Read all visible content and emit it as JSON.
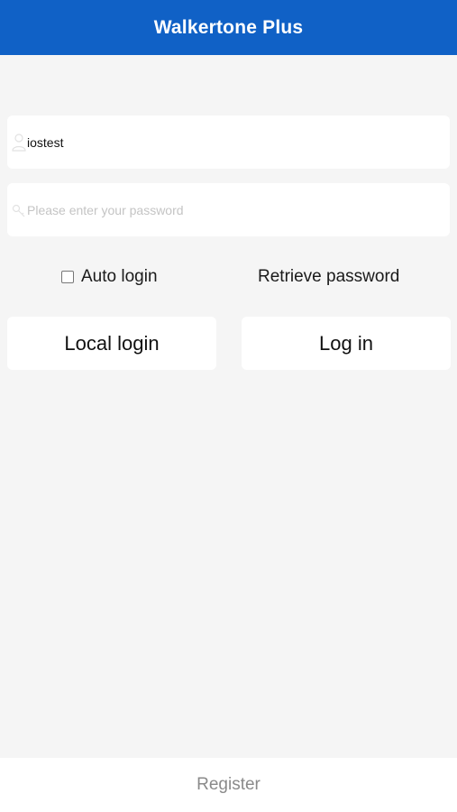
{
  "header": {
    "title": "Walkertone Plus",
    "background": "#1061c6"
  },
  "username": {
    "icon": "user-icon",
    "value": "iostest"
  },
  "password": {
    "icon": "key-icon",
    "placeholder": "Please enter your password"
  },
  "options": {
    "auto_login_label": "Auto login",
    "auto_login_checked": false,
    "retrieve_password_label": "Retrieve password"
  },
  "buttons": {
    "local_login": "Local login",
    "log_in": "Log in"
  },
  "footer": {
    "register_label": "Register"
  }
}
